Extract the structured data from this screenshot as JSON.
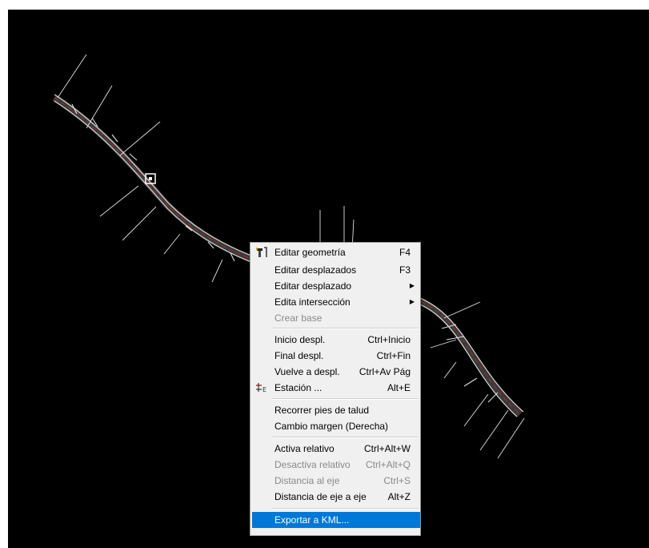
{
  "canvas": {
    "background": "#000000",
    "road_color": "#d8d8d8",
    "accent_color": "#cc2222"
  },
  "context_menu": {
    "items": [
      {
        "label": "Editar geometría",
        "shortcut": "F4",
        "icon": "edit-geometry-icon",
        "submenu": false,
        "enabled": true
      },
      {
        "label": "Editar desplazados",
        "shortcut": "F3",
        "icon": "",
        "submenu": false,
        "enabled": true
      },
      {
        "label": "Editar desplazado",
        "shortcut": "",
        "icon": "",
        "submenu": true,
        "enabled": true
      },
      {
        "label": "Edita intersección",
        "shortcut": "",
        "icon": "",
        "submenu": true,
        "enabled": true
      },
      {
        "label": "Crear base",
        "shortcut": "",
        "icon": "",
        "submenu": false,
        "enabled": false
      },
      {
        "label": "Inicio despl.",
        "shortcut": "Ctrl+Inicio",
        "icon": "",
        "submenu": false,
        "enabled": true
      },
      {
        "label": "Final despl.",
        "shortcut": "Ctrl+Fin",
        "icon": "",
        "submenu": false,
        "enabled": true
      },
      {
        "label": "Vuelve a despl.",
        "shortcut": "Ctrl+Av Pág",
        "icon": "",
        "submenu": false,
        "enabled": true
      },
      {
        "label": "Estación ...",
        "shortcut": "Alt+E",
        "icon": "station-icon",
        "submenu": false,
        "enabled": true
      },
      {
        "label": "Recorrer pies de talud",
        "shortcut": "",
        "icon": "",
        "submenu": false,
        "enabled": true
      },
      {
        "label": "Cambio margen (Derecha)",
        "shortcut": "",
        "icon": "",
        "submenu": false,
        "enabled": true
      },
      {
        "label": "Activa relativo",
        "shortcut": "Ctrl+Alt+W",
        "icon": "",
        "submenu": false,
        "enabled": true
      },
      {
        "label": "Desactiva relativo",
        "shortcut": "Ctrl+Alt+Q",
        "icon": "",
        "submenu": false,
        "enabled": false
      },
      {
        "label": "Distancia al eje",
        "shortcut": "Ctrl+S",
        "icon": "",
        "submenu": false,
        "enabled": false
      },
      {
        "label": "Distancia de eje a eje",
        "shortcut": "Alt+Z",
        "icon": "",
        "submenu": false,
        "enabled": true
      },
      {
        "label": "Exportar a KML...",
        "shortcut": "",
        "icon": "",
        "submenu": false,
        "enabled": true,
        "selected": true
      }
    ]
  }
}
